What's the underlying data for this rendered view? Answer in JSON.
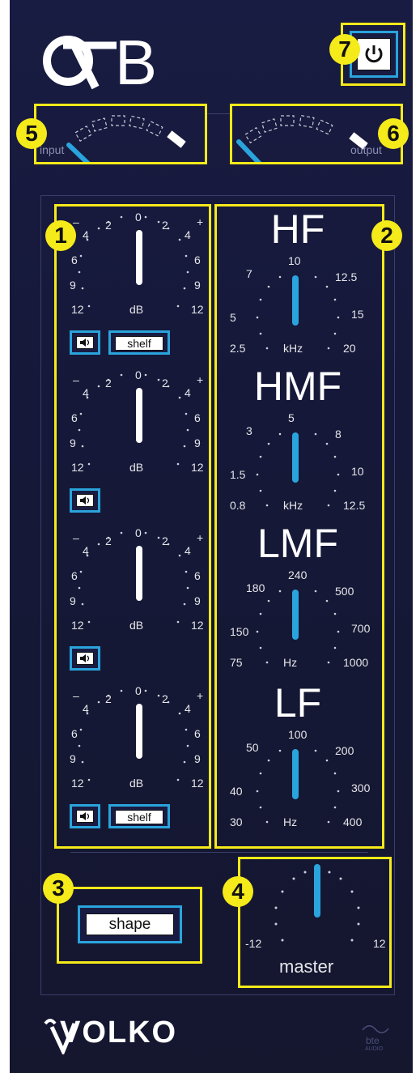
{
  "header": {
    "logo": "QFB"
  },
  "annotations": [
    "1",
    "2",
    "3",
    "4",
    "5",
    "6",
    "7"
  ],
  "power": {
    "icon": "power-icon"
  },
  "meters": {
    "input_label": "input",
    "output_label": "output"
  },
  "gain_bands": [
    {
      "scale_left": [
        "–",
        "4",
        "6",
        "9",
        "12"
      ],
      "scale_top": [
        "2",
        "0",
        "2"
      ],
      "scale_right": [
        "+",
        "4",
        "6",
        "9",
        "12"
      ],
      "unit": "dB",
      "has_shelf": true
    },
    {
      "scale_left": [
        "–",
        "4",
        "6",
        "9",
        "12"
      ],
      "scale_top": [
        "2",
        "0",
        "2"
      ],
      "scale_right": [
        "+",
        "4",
        "6",
        "9",
        "12"
      ],
      "unit": "dB",
      "has_shelf": false
    },
    {
      "scale_left": [
        "–",
        "4",
        "6",
        "9",
        "12"
      ],
      "scale_top": [
        "2",
        "0",
        "2"
      ],
      "scale_right": [
        "+",
        "4",
        "6",
        "9",
        "12"
      ],
      "unit": "dB",
      "has_shelf": false
    },
    {
      "scale_left": [
        "–",
        "4",
        "6",
        "9",
        "12"
      ],
      "scale_top": [
        "2",
        "0",
        "2"
      ],
      "scale_right": [
        "+",
        "4",
        "6",
        "9",
        "12"
      ],
      "unit": "dB",
      "has_shelf": true
    }
  ],
  "shelf_label": "shelf",
  "freq_bands": [
    {
      "name": "HF",
      "top": "10",
      "l1": "7",
      "r1": "12.5",
      "l2": "5",
      "r2": "15",
      "l3": "2.5",
      "r3": "20",
      "unit": "kHz"
    },
    {
      "name": "HMF",
      "top": "5",
      "l1": "3",
      "r1": "8",
      "l2": "1.5",
      "r2": "10",
      "l3": "0.8",
      "r3": "12.5",
      "unit": "kHz"
    },
    {
      "name": "LMF",
      "top": "240",
      "l1": "180",
      "r1": "500",
      "l2": "150",
      "r2": "700",
      "l3": "75",
      "r3": "1000",
      "unit": "Hz"
    },
    {
      "name": "LF",
      "top": "100",
      "l1": "50",
      "r1": "200",
      "l2": "40",
      "r2": "300",
      "l3": "30",
      "r3": "400",
      "unit": "Hz"
    }
  ],
  "shape": {
    "label": "shape"
  },
  "master": {
    "label": "master",
    "min": "-12",
    "max": "12"
  },
  "footer": {
    "brand": "VOLKO",
    "vendor_top": "bte",
    "vendor_bottom": "AUDIO"
  },
  "colors": {
    "accent": "#2aa4dc",
    "highlight": "#f5ea1a",
    "panel": "#191c42"
  }
}
